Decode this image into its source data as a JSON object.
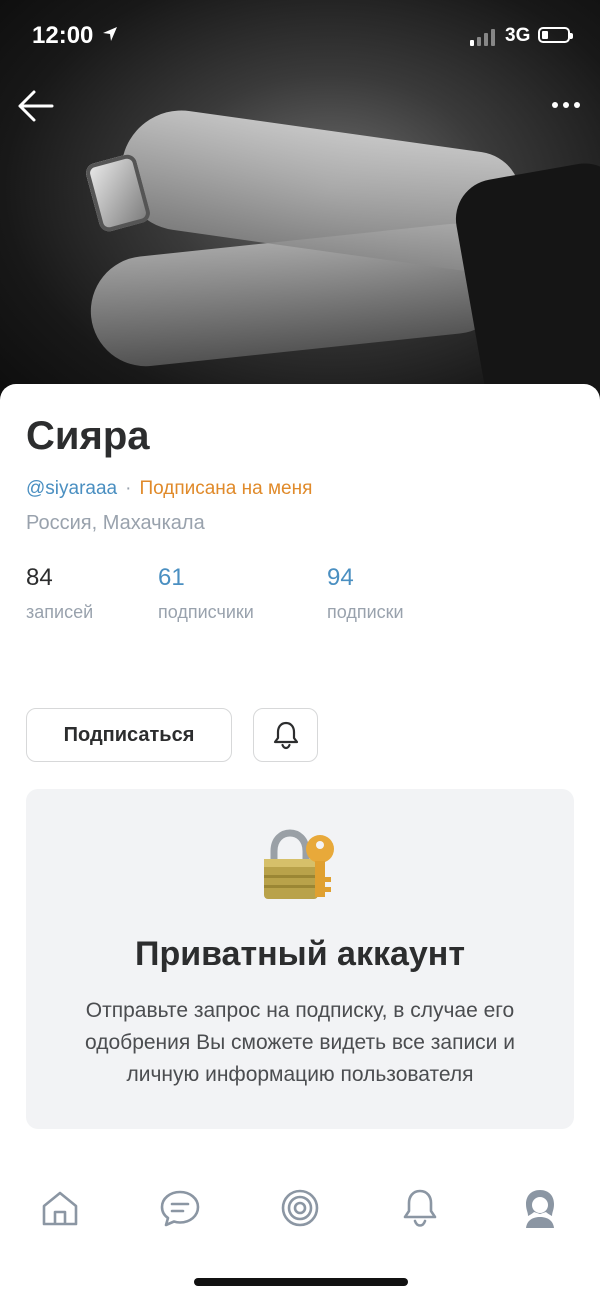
{
  "status_bar": {
    "time": "12:00",
    "network": "3G"
  },
  "profile": {
    "name": "Сияра",
    "handle": "@siyaraaa",
    "separator": "·",
    "follows_me": "Подписана на меня",
    "location": "Россия, Махачкала"
  },
  "stats": [
    {
      "value": "84",
      "label": "записей"
    },
    {
      "value": "61",
      "label": "подписчики"
    },
    {
      "value": "94",
      "label": "подписки"
    }
  ],
  "actions": {
    "follow_label": "Подписаться"
  },
  "private": {
    "title": "Приватный аккаунт",
    "text": "Отправьте запрос на подписку, в случае его одобрения Вы сможете видеть все записи и личную информацию пользователя"
  },
  "colors": {
    "link": "#4a8fc1",
    "accent_orange": "#e08a2a",
    "muted": "#99a2ad",
    "tab_icon": "#8b96a3"
  },
  "icons": [
    "back-arrow-icon",
    "more-dots-icon",
    "bell-icon",
    "lock-key-icon",
    "home-icon",
    "messages-icon",
    "discover-icon",
    "notifications-icon",
    "profile-icon"
  ]
}
